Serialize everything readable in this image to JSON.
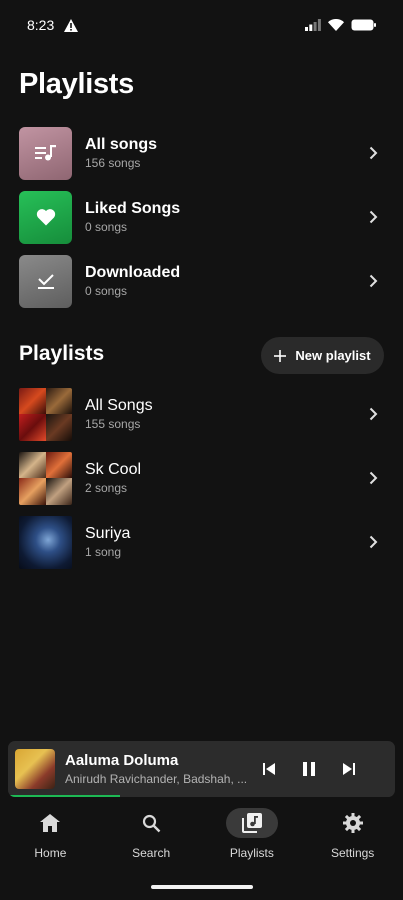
{
  "status": {
    "time": "8:23"
  },
  "title": "Playlists",
  "library": [
    {
      "title": "All songs",
      "subtitle": "156 songs",
      "icon": "queue-music-icon",
      "color": "#b07f8e"
    },
    {
      "title": "Liked Songs",
      "subtitle": "0 songs",
      "icon": "heart-icon",
      "color": "#1ea94a"
    },
    {
      "title": "Downloaded",
      "subtitle": "0 songs",
      "icon": "download-done-icon",
      "color": "#737373"
    }
  ],
  "section": {
    "title": "Playlists",
    "new_playlist_label": "New playlist"
  },
  "playlists": [
    {
      "title": "All Songs",
      "subtitle": "155 songs"
    },
    {
      "title": "Sk Cool",
      "subtitle": "2 songs"
    },
    {
      "title": "Suriya",
      "subtitle": "1 song"
    }
  ],
  "now_playing": {
    "title": "Aaluma Doluma",
    "artist": "Anirudh Ravichander, Badshah, ...",
    "progress": 0.29,
    "accent": "#1db954"
  },
  "nav": [
    {
      "label": "Home",
      "icon": "home-icon",
      "active": false
    },
    {
      "label": "Search",
      "icon": "search-icon",
      "active": false
    },
    {
      "label": "Playlists",
      "icon": "library-music-icon",
      "active": true
    },
    {
      "label": "Settings",
      "icon": "gear-icon",
      "active": false
    }
  ]
}
